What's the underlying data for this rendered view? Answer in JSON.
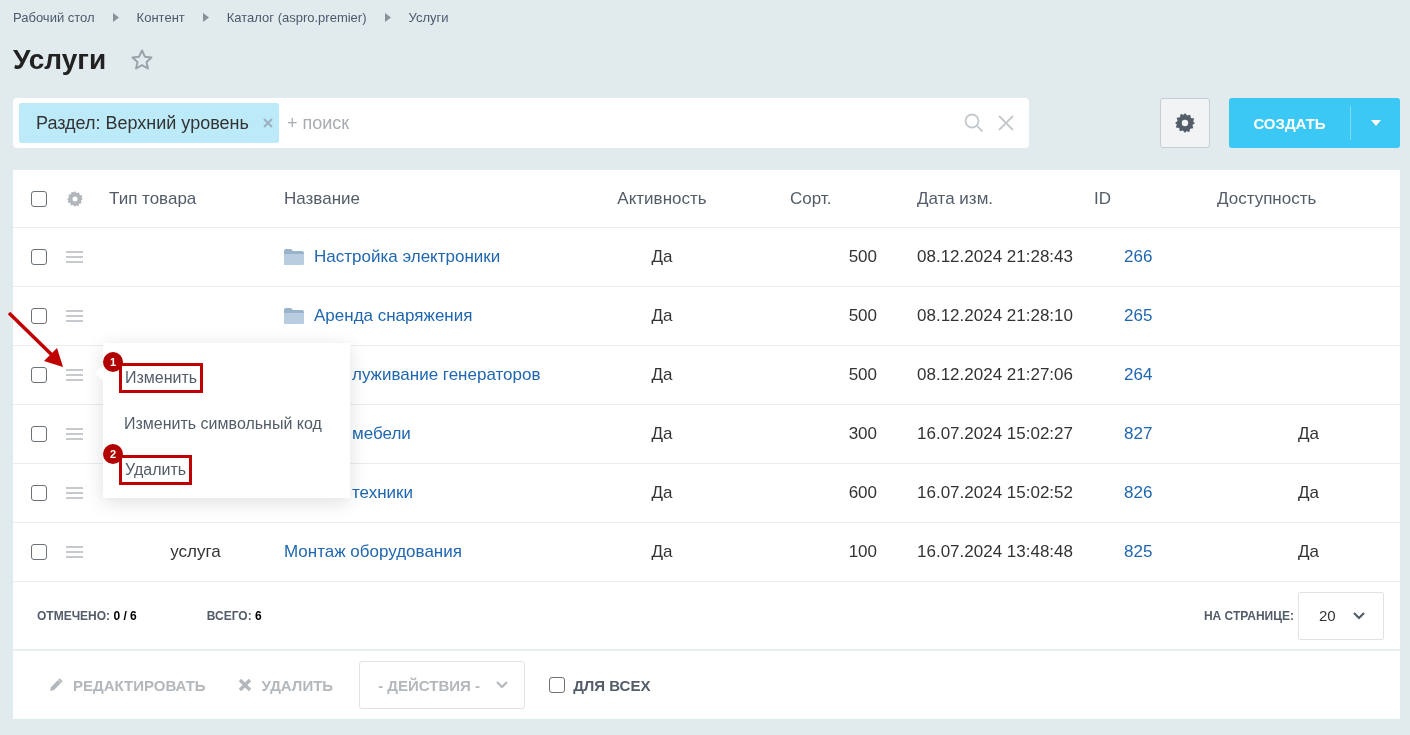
{
  "breadcrumbs": [
    "Рабочий стол",
    "Контент",
    "Каталог (aspro.premier)",
    "Услуги"
  ],
  "page_title": "Услуги",
  "favorite": false,
  "filter": {
    "chip": "Раздел: Верхний уровень",
    "placeholder": "+ поиск"
  },
  "create_button": "СОЗДАТЬ",
  "table": {
    "select_all": false,
    "columns": [
      "Тип товара",
      "Название",
      "Активность",
      "Сорт.",
      "Дата изм.",
      "ID",
      "Доступность"
    ],
    "rows": [
      {
        "checked": false,
        "kind": "folder",
        "type": "",
        "name": "Настройка электроники",
        "active": "Да",
        "sort": "500",
        "date": "08.12.2024 21:28:43",
        "id": "266",
        "availability": ""
      },
      {
        "checked": false,
        "kind": "folder",
        "type": "",
        "name": "Аренда снаряжения",
        "active": "Да",
        "sort": "500",
        "date": "08.12.2024 21:28:10",
        "id": "265",
        "availability": ""
      },
      {
        "checked": false,
        "kind": "cut",
        "type": "",
        "name": "луживание генераторов",
        "active": "Да",
        "sort": "500",
        "date": "08.12.2024 21:27:06",
        "id": "264",
        "availability": ""
      },
      {
        "checked": false,
        "kind": "cut",
        "type": "",
        "name": "мебели",
        "active": "Да",
        "sort": "300",
        "date": "16.07.2024 15:02:27",
        "id": "827",
        "availability": "Да"
      },
      {
        "checked": false,
        "kind": "cut",
        "type": "",
        "name": "техники",
        "active": "Да",
        "sort": "600",
        "date": "16.07.2024 15:02:52",
        "id": "826",
        "availability": "Да"
      },
      {
        "checked": false,
        "kind": "item",
        "type": "услуга",
        "name": "Монтаж оборудования",
        "active": "Да",
        "sort": "100",
        "date": "16.07.2024 13:48:48",
        "id": "825",
        "availability": "Да"
      }
    ]
  },
  "context_menu": {
    "items": [
      {
        "label": "Изменить",
        "marker": "1",
        "highlighted": true
      },
      {
        "label": "Изменить символьный код",
        "highlighted": false
      },
      {
        "label": "Удалить",
        "marker": "2",
        "highlighted": true
      }
    ]
  },
  "footer": {
    "checked_label": "ОТМЕЧЕНО:",
    "checked_value": "0 / 6",
    "total_label": "ВСЕГО:",
    "total_value": "6",
    "per_page_label": "НА СТРАНИЦЕ:",
    "per_page": "20"
  },
  "actions": {
    "edit": "РЕДАКТИРОВАТЬ",
    "delete": "УДАЛИТЬ",
    "select": "- ДЕЙСТВИЯ -",
    "for_all": "ДЛЯ ВСЕХ",
    "for_all_checked": false
  }
}
